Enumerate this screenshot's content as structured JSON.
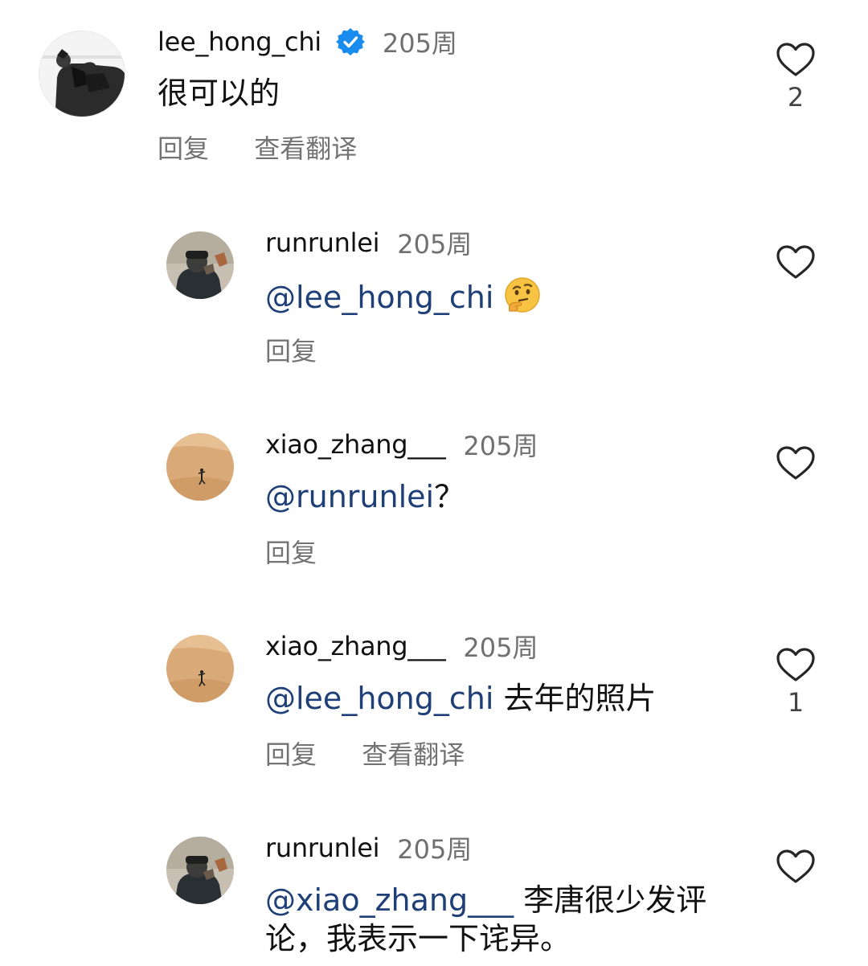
{
  "comments": [
    {
      "username": "lee_hong_chi",
      "time": "205周",
      "text": "很可以的",
      "reply_label": "回复",
      "translate_label": "查看翻译",
      "likes": "2"
    },
    {
      "username": "runrunlei",
      "time": "205周",
      "mention": "@lee_hong_chi",
      "text": "",
      "emoji": "thinking-face-emoji",
      "reply_label": "回复"
    },
    {
      "username": "xiao_zhang___",
      "time": "205周",
      "mention": "@runrunlei",
      "text": "？",
      "reply_label": "回复"
    },
    {
      "username": "xiao_zhang___",
      "time": "205周",
      "mention": "@lee_hong_chi",
      "text": "去年的照片",
      "reply_label": "回复",
      "translate_label": "查看翻译",
      "likes": "1"
    },
    {
      "username": "runrunlei",
      "time": "205周",
      "mention": "@xiao_zhang___",
      "text": "李唐很少发评",
      "text_line2": "论，我表示一下诧异。"
    }
  ],
  "colors": {
    "mention": "#1e3f77",
    "secondary_text": "#737373",
    "verified": "#1a8cf0"
  },
  "icons": {
    "like": "heart-outline-icon",
    "verified": "verified-badge-icon"
  }
}
